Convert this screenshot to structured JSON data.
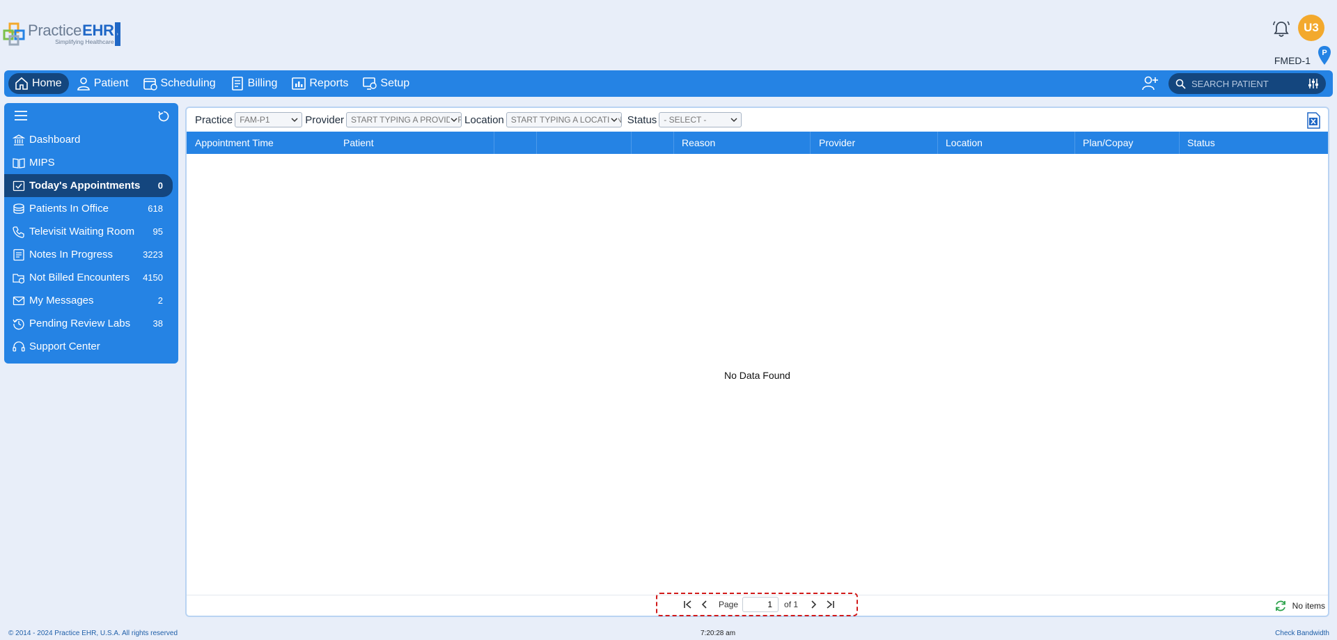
{
  "brand": {
    "name_part1": "Practice",
    "name_part2": "EHR",
    "tagline": "Simplifying Healthcare"
  },
  "user": {
    "initials": "U3",
    "facility": "FMED-1",
    "pin_label": "P"
  },
  "nav": {
    "items": [
      {
        "label": "Home",
        "icon": "home-icon"
      },
      {
        "label": "Patient",
        "icon": "user-icon"
      },
      {
        "label": "Scheduling",
        "icon": "calendar-icon"
      },
      {
        "label": "Billing",
        "icon": "billing-icon"
      },
      {
        "label": "Reports",
        "icon": "reports-icon"
      },
      {
        "label": "Setup",
        "icon": "setup-icon"
      }
    ],
    "search_placeholder": "SEARCH PATIENT"
  },
  "sidebar": {
    "items": [
      {
        "label": "Dashboard",
        "count": ""
      },
      {
        "label": "MIPS",
        "count": ""
      },
      {
        "label": "Today's Appointments",
        "count": "0"
      },
      {
        "label": "Patients In Office",
        "count": "618"
      },
      {
        "label": "Televisit Waiting Room",
        "count": "95"
      },
      {
        "label": "Notes In Progress",
        "count": "3223"
      },
      {
        "label": "Not Billed Encounters",
        "count": "4150"
      },
      {
        "label": "My Messages",
        "count": "2"
      },
      {
        "label": "Pending Review Labs",
        "count": "38"
      },
      {
        "label": "Support Center",
        "count": ""
      }
    ]
  },
  "filters": {
    "practice_label": "Practice",
    "practice_value": "FAM-P1",
    "provider_label": "Provider",
    "provider_placeholder": "START TYPING A PROVIDER",
    "location_label": "Location",
    "location_placeholder": "START TYPING A LOCATION",
    "status_label": "Status",
    "status_value": "- SELECT -"
  },
  "table": {
    "columns": [
      "Appointment Time",
      "Patient",
      "Reason",
      "Provider",
      "Location",
      "Plan/Copay",
      "Status"
    ],
    "empty_message": "No Data Found"
  },
  "pager": {
    "page_label": "Page",
    "page_value": "1",
    "of_label": "of 1",
    "items_label": "No items"
  },
  "footer": {
    "copyright": "© 2014 - 2024 Practice EHR, U.S.A. All rights reserved",
    "time": "7:20:28 am",
    "bandwidth": "Check Bandwidth"
  },
  "colors": {
    "nav": "#2583e4",
    "nav_active": "#14467e",
    "avatar": "#f3a92d",
    "pager_border": "#d11a1a"
  }
}
